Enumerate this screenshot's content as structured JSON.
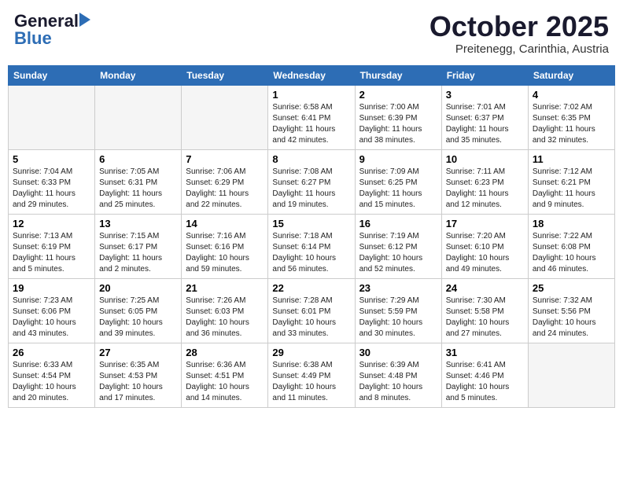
{
  "header": {
    "logo_line1": "General",
    "logo_line2": "Blue",
    "month": "October 2025",
    "location": "Preitenegg, Carinthia, Austria"
  },
  "days_of_week": [
    "Sunday",
    "Monday",
    "Tuesday",
    "Wednesday",
    "Thursday",
    "Friday",
    "Saturday"
  ],
  "weeks": [
    [
      {
        "day": "",
        "info": ""
      },
      {
        "day": "",
        "info": ""
      },
      {
        "day": "",
        "info": ""
      },
      {
        "day": "1",
        "info": "Sunrise: 6:58 AM\nSunset: 6:41 PM\nDaylight: 11 hours\nand 42 minutes."
      },
      {
        "day": "2",
        "info": "Sunrise: 7:00 AM\nSunset: 6:39 PM\nDaylight: 11 hours\nand 38 minutes."
      },
      {
        "day": "3",
        "info": "Sunrise: 7:01 AM\nSunset: 6:37 PM\nDaylight: 11 hours\nand 35 minutes."
      },
      {
        "day": "4",
        "info": "Sunrise: 7:02 AM\nSunset: 6:35 PM\nDaylight: 11 hours\nand 32 minutes."
      }
    ],
    [
      {
        "day": "5",
        "info": "Sunrise: 7:04 AM\nSunset: 6:33 PM\nDaylight: 11 hours\nand 29 minutes."
      },
      {
        "day": "6",
        "info": "Sunrise: 7:05 AM\nSunset: 6:31 PM\nDaylight: 11 hours\nand 25 minutes."
      },
      {
        "day": "7",
        "info": "Sunrise: 7:06 AM\nSunset: 6:29 PM\nDaylight: 11 hours\nand 22 minutes."
      },
      {
        "day": "8",
        "info": "Sunrise: 7:08 AM\nSunset: 6:27 PM\nDaylight: 11 hours\nand 19 minutes."
      },
      {
        "day": "9",
        "info": "Sunrise: 7:09 AM\nSunset: 6:25 PM\nDaylight: 11 hours\nand 15 minutes."
      },
      {
        "day": "10",
        "info": "Sunrise: 7:11 AM\nSunset: 6:23 PM\nDaylight: 11 hours\nand 12 minutes."
      },
      {
        "day": "11",
        "info": "Sunrise: 7:12 AM\nSunset: 6:21 PM\nDaylight: 11 hours\nand 9 minutes."
      }
    ],
    [
      {
        "day": "12",
        "info": "Sunrise: 7:13 AM\nSunset: 6:19 PM\nDaylight: 11 hours\nand 5 minutes."
      },
      {
        "day": "13",
        "info": "Sunrise: 7:15 AM\nSunset: 6:17 PM\nDaylight: 11 hours\nand 2 minutes."
      },
      {
        "day": "14",
        "info": "Sunrise: 7:16 AM\nSunset: 6:16 PM\nDaylight: 10 hours\nand 59 minutes."
      },
      {
        "day": "15",
        "info": "Sunrise: 7:18 AM\nSunset: 6:14 PM\nDaylight: 10 hours\nand 56 minutes."
      },
      {
        "day": "16",
        "info": "Sunrise: 7:19 AM\nSunset: 6:12 PM\nDaylight: 10 hours\nand 52 minutes."
      },
      {
        "day": "17",
        "info": "Sunrise: 7:20 AM\nSunset: 6:10 PM\nDaylight: 10 hours\nand 49 minutes."
      },
      {
        "day": "18",
        "info": "Sunrise: 7:22 AM\nSunset: 6:08 PM\nDaylight: 10 hours\nand 46 minutes."
      }
    ],
    [
      {
        "day": "19",
        "info": "Sunrise: 7:23 AM\nSunset: 6:06 PM\nDaylight: 10 hours\nand 43 minutes."
      },
      {
        "day": "20",
        "info": "Sunrise: 7:25 AM\nSunset: 6:05 PM\nDaylight: 10 hours\nand 39 minutes."
      },
      {
        "day": "21",
        "info": "Sunrise: 7:26 AM\nSunset: 6:03 PM\nDaylight: 10 hours\nand 36 minutes."
      },
      {
        "day": "22",
        "info": "Sunrise: 7:28 AM\nSunset: 6:01 PM\nDaylight: 10 hours\nand 33 minutes."
      },
      {
        "day": "23",
        "info": "Sunrise: 7:29 AM\nSunset: 5:59 PM\nDaylight: 10 hours\nand 30 minutes."
      },
      {
        "day": "24",
        "info": "Sunrise: 7:30 AM\nSunset: 5:58 PM\nDaylight: 10 hours\nand 27 minutes."
      },
      {
        "day": "25",
        "info": "Sunrise: 7:32 AM\nSunset: 5:56 PM\nDaylight: 10 hours\nand 24 minutes."
      }
    ],
    [
      {
        "day": "26",
        "info": "Sunrise: 6:33 AM\nSunset: 4:54 PM\nDaylight: 10 hours\nand 20 minutes."
      },
      {
        "day": "27",
        "info": "Sunrise: 6:35 AM\nSunset: 4:53 PM\nDaylight: 10 hours\nand 17 minutes."
      },
      {
        "day": "28",
        "info": "Sunrise: 6:36 AM\nSunset: 4:51 PM\nDaylight: 10 hours\nand 14 minutes."
      },
      {
        "day": "29",
        "info": "Sunrise: 6:38 AM\nSunset: 4:49 PM\nDaylight: 10 hours\nand 11 minutes."
      },
      {
        "day": "30",
        "info": "Sunrise: 6:39 AM\nSunset: 4:48 PM\nDaylight: 10 hours\nand 8 minutes."
      },
      {
        "day": "31",
        "info": "Sunrise: 6:41 AM\nSunset: 4:46 PM\nDaylight: 10 hours\nand 5 minutes."
      },
      {
        "day": "",
        "info": ""
      }
    ]
  ]
}
